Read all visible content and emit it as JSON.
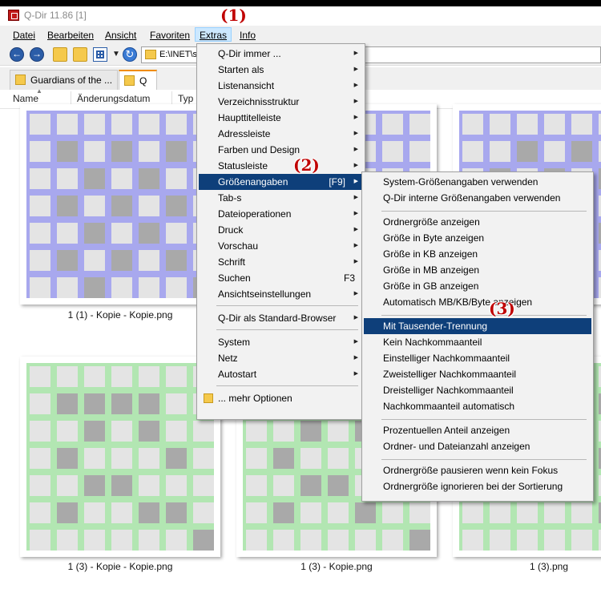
{
  "window": {
    "title": "Q-Dir 11.86 [1]"
  },
  "menubar": [
    "Datei",
    "Bearbeiten",
    "Ansicht",
    "Favoriten",
    "Extras",
    "Info"
  ],
  "address": {
    "path": "E:\\INET\\s"
  },
  "tabs": [
    {
      "label": "Guardians of the ..."
    },
    {
      "label": "Q"
    }
  ],
  "columns": [
    "Name",
    "Änderungsdatum",
    "Typ"
  ],
  "files": [
    {
      "caption": "1 (1) - Kopie - Kopie.png",
      "tint": "#a8a8ee",
      "filled": [
        [
          1,
          1
        ],
        [
          3,
          1
        ],
        [
          5,
          1
        ],
        [
          2,
          2
        ],
        [
          4,
          2
        ],
        [
          1,
          3
        ],
        [
          3,
          3
        ],
        [
          5,
          3
        ],
        [
          2,
          4
        ],
        [
          4,
          4
        ],
        [
          1,
          5
        ],
        [
          3,
          5
        ],
        [
          5,
          5
        ],
        [
          2,
          6
        ],
        [
          6,
          6
        ]
      ]
    },
    {
      "caption": "",
      "tint": "#a8a8ee",
      "filled": []
    },
    {
      "caption": "",
      "tint": "#a8a8ee",
      "filled": [
        [
          2,
          1
        ],
        [
          4,
          1
        ],
        [
          6,
          1
        ],
        [
          1,
          2
        ],
        [
          3,
          2
        ],
        [
          5,
          2
        ],
        [
          2,
          3
        ],
        [
          4,
          3
        ],
        [
          6,
          3
        ],
        [
          1,
          4
        ],
        [
          3,
          4
        ],
        [
          5,
          4
        ],
        [
          2,
          5
        ],
        [
          4,
          5
        ]
      ]
    },
    {
      "caption": "1 (3) - Kopie - Kopie.png",
      "tint": "#b2e6b2",
      "filled": [
        [
          1,
          1
        ],
        [
          2,
          1
        ],
        [
          3,
          1
        ],
        [
          4,
          1
        ],
        [
          2,
          2
        ],
        [
          4,
          2
        ],
        [
          1,
          3
        ],
        [
          5,
          3
        ],
        [
          2,
          4
        ],
        [
          3,
          4
        ],
        [
          1,
          5
        ],
        [
          4,
          5
        ],
        [
          5,
          5
        ],
        [
          6,
          6
        ]
      ]
    },
    {
      "caption": "1 (3) - Kopie.png",
      "tint": "#b2e6b2",
      "filled": [
        [
          1,
          1
        ],
        [
          3,
          1
        ],
        [
          2,
          2
        ],
        [
          4,
          2
        ],
        [
          1,
          3
        ],
        [
          5,
          3
        ],
        [
          2,
          4
        ],
        [
          3,
          4
        ],
        [
          1,
          5
        ],
        [
          4,
          5
        ],
        [
          6,
          6
        ]
      ]
    },
    {
      "caption": "1 (3).png",
      "tint": "#b2e6b2",
      "filled": [
        [
          4,
          1
        ],
        [
          5,
          1
        ],
        [
          4,
          2
        ],
        [
          5,
          3
        ],
        [
          4,
          4
        ],
        [
          5,
          5
        ]
      ]
    }
  ],
  "extras_menu": [
    {
      "label": "Q-Dir immer ...",
      "submenu": true
    },
    {
      "label": "Starten als",
      "submenu": true
    },
    {
      "label": "Listenansicht",
      "submenu": true
    },
    {
      "label": "Verzeichnisstruktur",
      "submenu": true
    },
    {
      "label": "Haupttitelleiste",
      "submenu": true
    },
    {
      "label": "Adressleiste",
      "submenu": true
    },
    {
      "label": "Farben und Design",
      "submenu": true
    },
    {
      "label": "Statusleiste",
      "submenu": true
    },
    {
      "label": "Größenangaben",
      "submenu": true,
      "shortcut": "[F9]",
      "highlighted": true
    },
    {
      "label": "Tab-s",
      "submenu": true
    },
    {
      "label": "Dateioperationen",
      "submenu": true
    },
    {
      "label": "Druck",
      "submenu": true
    },
    {
      "label": "Vorschau",
      "submenu": true
    },
    {
      "label": "Schrift",
      "submenu": true
    },
    {
      "label": "Suchen",
      "shortcut": "F3"
    },
    {
      "label": "Ansichtseinstellungen",
      "submenu": true
    },
    {
      "separator": true
    },
    {
      "label": "Q-Dir als Standard-Browser",
      "submenu": true
    },
    {
      "separator": true
    },
    {
      "label": "System",
      "submenu": true
    },
    {
      "label": "Netz",
      "submenu": true
    },
    {
      "label": "Autostart",
      "submenu": true
    },
    {
      "separator": true
    },
    {
      "label": "... mehr Optionen",
      "icon": "folder-icon"
    }
  ],
  "size_submenu": [
    {
      "label": "System-Größenangaben verwenden"
    },
    {
      "label": "Q-Dir interne Größenangaben verwenden"
    },
    {
      "separator": true
    },
    {
      "label": "Ordnergröße anzeigen"
    },
    {
      "label": "Größe in Byte anzeigen"
    },
    {
      "label": "Größe in KB anzeigen"
    },
    {
      "label": "Größe in MB anzeigen"
    },
    {
      "label": "Größe in GB anzeigen"
    },
    {
      "label": "Automatisch MB/KB/Byte anzeigen"
    },
    {
      "separator": true
    },
    {
      "label": "Mit Tausender-Trennung",
      "highlighted": true
    },
    {
      "label": "Kein Nachkommaanteil"
    },
    {
      "label": "Einstelliger Nachkommaanteil"
    },
    {
      "label": "Zweistelliger Nachkommaanteil"
    },
    {
      "label": "Dreistelliger Nachkommaanteil"
    },
    {
      "label": "Nachkommaanteil automatisch"
    },
    {
      "separator": true
    },
    {
      "label": "Prozentuellen Anteil anzeigen"
    },
    {
      "label": "Ordner- und Dateianzahl anzeigen"
    },
    {
      "separator": true
    },
    {
      "label": "Ordnergröße pausieren wenn kein Fokus"
    },
    {
      "label": "Ordnergröße ignorieren bei der Sortierung"
    }
  ],
  "annotations": [
    "(1)",
    "(2)",
    "(3)"
  ],
  "colors": {
    "highlight": "#0e3f7a",
    "annotation": "#c00000",
    "menu_active": "#cce8ff"
  }
}
